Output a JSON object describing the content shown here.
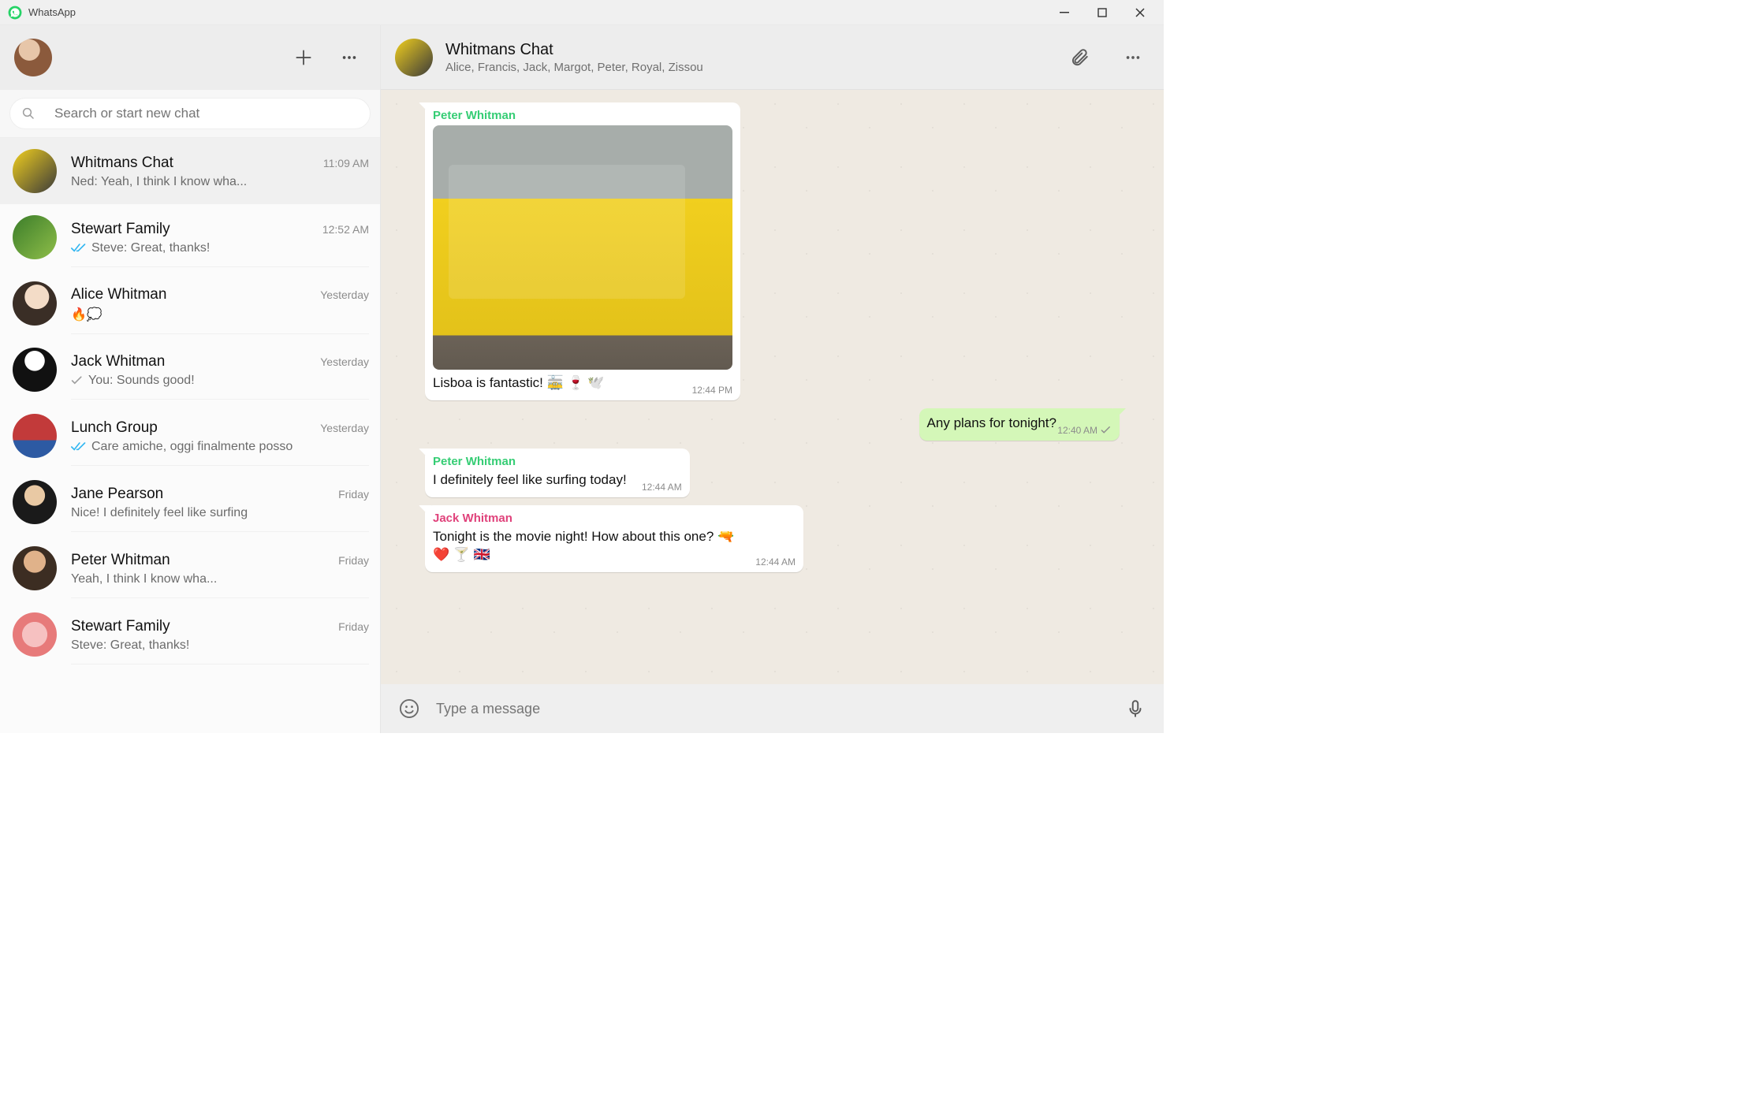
{
  "window": {
    "title": "WhatsApp"
  },
  "left": {
    "search_placeholder": "Search or start new chat",
    "chats": [
      {
        "name": "Whitmans Chat",
        "time": "11:09 AM",
        "snippet": "Ned: Yeah, I think I know wha...",
        "tick": "none",
        "avatar": "av2"
      },
      {
        "name": "Stewart Family",
        "time": "12:52 AM",
        "snippet": "Steve: Great, thanks!",
        "tick": "read",
        "avatar": "av3"
      },
      {
        "name": "Alice Whitman",
        "time": "Yesterday",
        "snippet": "🔥💭",
        "tick": "none",
        "avatar": "av4"
      },
      {
        "name": "Jack Whitman",
        "time": "Yesterday",
        "snippet": "You: Sounds good!",
        "tick": "sent",
        "avatar": "av5"
      },
      {
        "name": "Lunch Group",
        "time": "Yesterday",
        "snippet": "Care amiche, oggi finalmente posso",
        "tick": "read",
        "avatar": "av6"
      },
      {
        "name": "Jane Pearson",
        "time": "Friday",
        "snippet": "Nice! I definitely feel like surfing",
        "tick": "none",
        "avatar": "av7"
      },
      {
        "name": "Peter Whitman",
        "time": "Friday",
        "snippet": "Yeah, I think I know wha...",
        "tick": "none",
        "avatar": "av8"
      },
      {
        "name": "Stewart Family",
        "time": "Friday",
        "snippet": "Steve: Great, thanks!",
        "tick": "none",
        "avatar": "av9"
      }
    ]
  },
  "conversation": {
    "title": "Whitmans Chat",
    "subtitle": "Alice, Francis, Jack, Margot, Peter, Royal, Zissou",
    "messages": [
      {
        "dir": "in",
        "tail": true,
        "sender": "Peter Whitman",
        "sender_color": "#35cd74",
        "has_image": true,
        "text": "Lisboa is fantastic! 🚋 🍷 🕊️",
        "time": "12:44 PM"
      },
      {
        "dir": "out",
        "tail": true,
        "sender": "",
        "sender_color": "",
        "has_image": false,
        "text": "Any plans for tonight?",
        "time": "12:40 AM",
        "out_tick": true
      },
      {
        "dir": "in",
        "tail": true,
        "sender": "Peter Whitman",
        "sender_color": "#35cd74",
        "has_image": false,
        "text": "I definitely feel like surfing today!",
        "time": "12:44 AM"
      },
      {
        "dir": "in",
        "tail": true,
        "sender": "Jack Whitman",
        "sender_color": "#e0427b",
        "has_image": false,
        "text": "Tonight is the movie night! How about this one? 🔫 ❤️ 🍸 🇬🇧",
        "time": "12:44 AM"
      }
    ]
  },
  "composer": {
    "placeholder": "Type a message"
  }
}
